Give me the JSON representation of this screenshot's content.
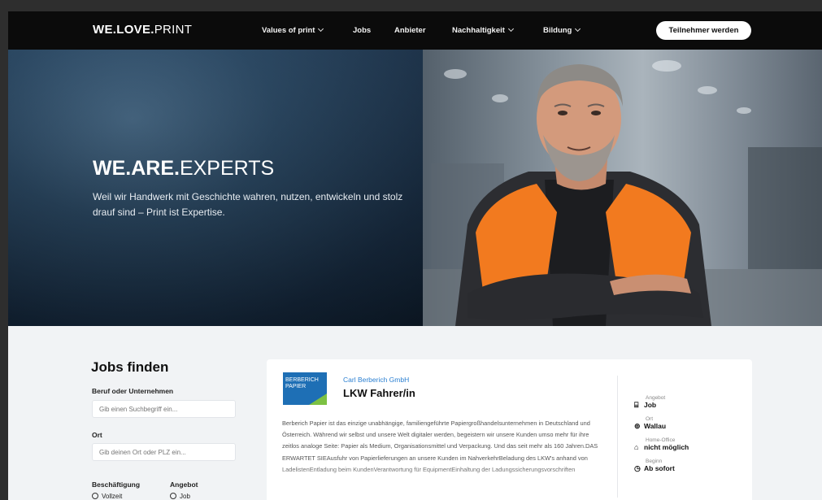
{
  "nav": {
    "logo_bold1": "WE.",
    "logo_bold2": "LOVE.",
    "logo_thin": "PRINT",
    "items": [
      {
        "label": "Values of print",
        "dropdown": true
      },
      {
        "label": "Jobs",
        "dropdown": false
      },
      {
        "label": "Anbieter",
        "dropdown": false
      },
      {
        "label": "Nachhaltigkeit",
        "dropdown": true
      },
      {
        "label": "Bildung",
        "dropdown": true
      }
    ],
    "cta": "Teilnehmer werden"
  },
  "hero": {
    "title_bold": "WE.ARE.",
    "title_thin": "EXPERTS",
    "subtitle": "Weil wir Handwerk mit Geschichte wahren, nutzen, entwickeln und stolz drauf sind – Print ist Expertise."
  },
  "finder": {
    "title": "Jobs finden",
    "search_label": "Beruf oder Unternehmen",
    "search_placeholder": "Gib einen Suchbegriff ein...",
    "location_label": "Ort",
    "location_placeholder": "Gib deinen Ort oder PLZ ein...",
    "employment_label": "Beschäftigung",
    "employment_option": "Vollzeit",
    "offer_label": "Angebot",
    "offer_option": "Job"
  },
  "job": {
    "logo_text": "BERBERICH PAPIER",
    "company": "Carl Berberich GmbH",
    "title": "LKW Fahrer/in",
    "description": "Berberich Papier ist das einzige unabhängige, familiengeführte Papiergroßhandelsunternehmen in Deutschland und Österreich. Während wir selbst und unsere Welt digitaler werden, begeistern wir unsere Kunden umso mehr für ihre zeitlos analoge Seite: Papier als Medium, Organisationsmittel und Verpackung. Und das seit mehr als 160 Jahren.DAS ERWARTET SIEAusfuhr von Papierlieferungen an unsere Kunden im NahverkehrBeladung des LKW's anhand von LadelistenEntladung beim KundenVerantwortung für EquipmentEinhaltung der Ladungssicherungsvorschriften",
    "meta": [
      {
        "label": "Angebot",
        "value": "Job",
        "icon": "briefcase-icon",
        "glyph": "⌸"
      },
      {
        "label": "Ort",
        "value": "Wallau",
        "icon": "location-pin-icon",
        "glyph": "⊚"
      },
      {
        "label": "Home-Office",
        "value": "nicht möglich",
        "icon": "home-icon",
        "glyph": "⌂"
      },
      {
        "label": "Beginn",
        "value": "Ab sofort",
        "icon": "clock-icon",
        "glyph": "◷"
      }
    ]
  },
  "colors": {
    "nav_bg": "#0b0b0b",
    "accent_link": "#2a7fd1",
    "page_bg": "#f1f3f5",
    "vest_orange": "#f27a1f"
  }
}
